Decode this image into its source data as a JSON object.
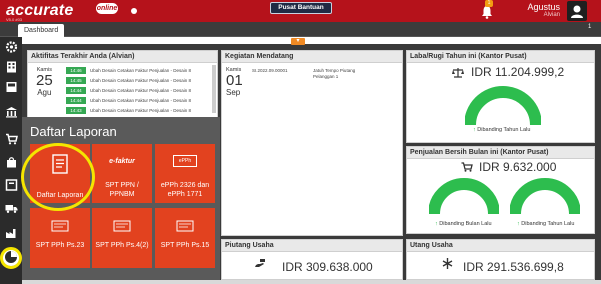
{
  "header": {
    "logo_text": "accurate",
    "logo_online": "online",
    "logo_version": "V5.0 #03",
    "help_label": "Pusat Bantuan",
    "notif_count": "1",
    "user_name": "Agustus",
    "user_sub": "Alvian"
  },
  "tabs": {
    "dashboard_label": "Dashboard",
    "tab_count": "1"
  },
  "activity": {
    "title": "Aktifitas Terakhir Anda (Alvian)",
    "date_day": "Kamis",
    "date_num": "25",
    "date_month": "Agu",
    "items": [
      {
        "time": "14:46",
        "text": "Ubah Desain Cetakan Faktur Penjualan - Desain 8"
      },
      {
        "time": "14:45",
        "text": "Ubah Desain Cetakan Faktur Penjualan - Desain 8"
      },
      {
        "time": "14:44",
        "text": "Ubah Desain Cetakan Faktur Penjualan - Desain 8"
      },
      {
        "time": "14:44",
        "text": "Ubah Desain Cetakan Faktur Penjualan - Desain 8"
      },
      {
        "time": "14:43",
        "text": "Ubah Desain Cetakan Faktur Penjualan - Desain 8"
      },
      {
        "time": "14:43",
        "text": "Ubah Desain Cetakan Faktur Penjualan - Desain 8"
      }
    ]
  },
  "upcoming": {
    "title": "Kegiatan Mendatang",
    "date_day": "Kamis",
    "date_num": "01",
    "date_month": "Sep",
    "item_code": "SI.2022.09.00001",
    "item_text_1": "Jatuh Tempo Piutang",
    "item_text_2": "Pelanggan 1"
  },
  "profit": {
    "title": "Laba/Rugi Tahun ini (Kantor Pusat)",
    "amount": "IDR 11.204.999,2",
    "compare_label": "Dibanding Tahun Lalu"
  },
  "sales": {
    "title": "Penjualan Bersih Bulan ini (Kantor Pusat)",
    "amount": "IDR 9.632.000",
    "compare_left": "Dibanding Bulan Lalu",
    "compare_right": "Dibanding Tahun Lalu"
  },
  "receivable": {
    "title": "Piutang Usaha",
    "amount": "IDR 309.638.000"
  },
  "payable": {
    "title": "Utang Usaha",
    "amount": "IDR 291.536.699,8"
  },
  "reports_popup": {
    "title": "Daftar Laporan",
    "tiles": [
      {
        "label": "Daftar Laporan",
        "icon": "report-list-icon"
      },
      {
        "label": "SPT PPN / PPNBM",
        "icon": "efaktur-icon",
        "icon_text": "e-faktur"
      },
      {
        "label": "ePPh 2326 dan ePPh 1771",
        "icon": "epph-icon",
        "icon_text": "ePPh"
      },
      {
        "label": "SPT PPh Ps.23",
        "icon": "tax-doc-icon"
      },
      {
        "label": "SPT PPh Ps.4(2)",
        "icon": "tax-doc-icon"
      },
      {
        "label": "SPT PPh Ps.15",
        "icon": "tax-doc-icon"
      }
    ]
  },
  "colors": {
    "brand_red": "#b5121b",
    "tile_orange": "#e2421f",
    "gauge_green": "#2dbd4e",
    "highlight_yellow": "#f5e500"
  }
}
